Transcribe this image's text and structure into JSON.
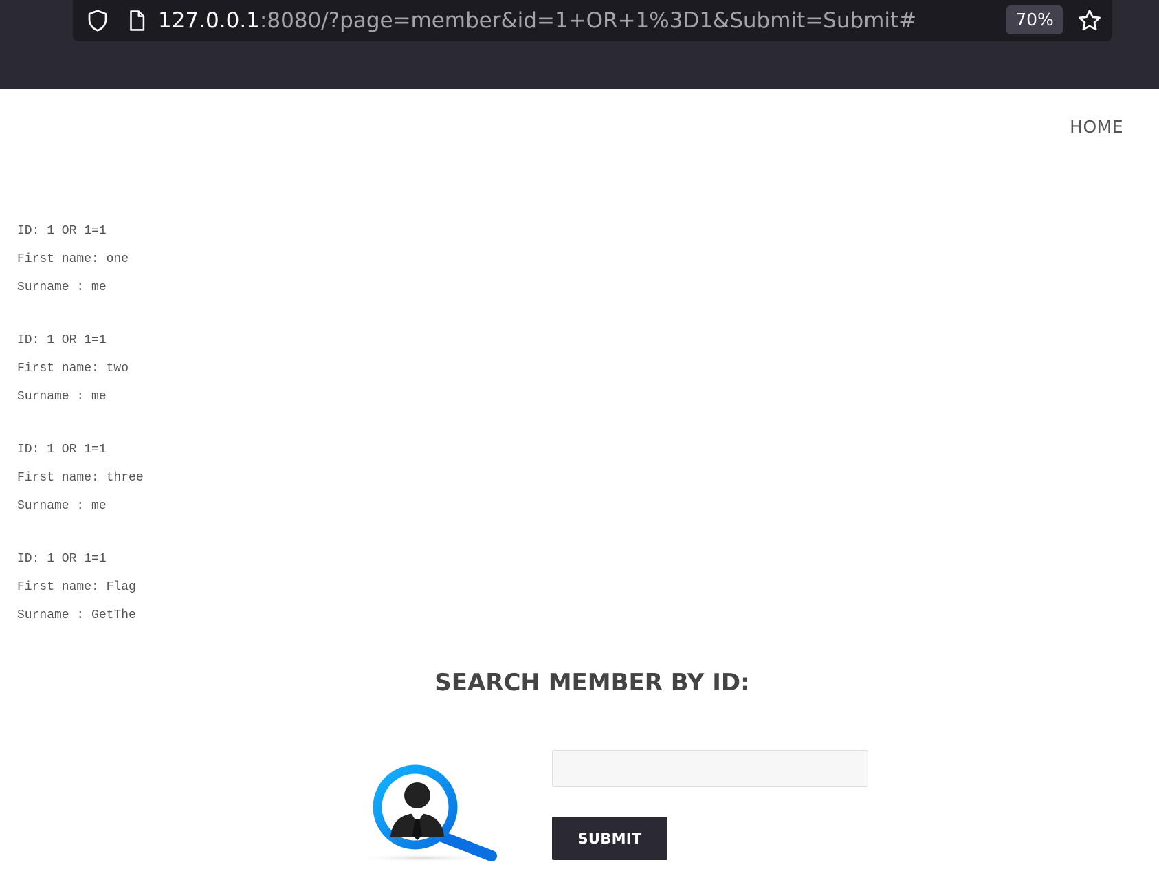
{
  "browser": {
    "url_host": "127.0.0.1",
    "url_rest": ":8080/?page=member&id=1+OR+1%3D1&Submit=Submit#",
    "zoom": "70%",
    "icons": [
      "shield-icon",
      "page-icon",
      "star-icon"
    ]
  },
  "nav": {
    "home_label": "HOME"
  },
  "results": [
    {
      "id": "ID: 1 OR 1=1",
      "first": "First name: one",
      "surname": "Surname : me"
    },
    {
      "id": "ID: 1 OR 1=1",
      "first": "First name: two",
      "surname": "Surname : me"
    },
    {
      "id": "ID: 1 OR 1=1",
      "first": "First name: three",
      "surname": "Surname : me"
    },
    {
      "id": "ID: 1 OR 1=1",
      "first": "First name: Flag",
      "surname": "Surname : GetThe"
    }
  ],
  "search": {
    "title": "SEARCH MEMBER BY ID:",
    "input_value": "",
    "submit_label": "SUBMIT"
  },
  "colors": {
    "chrome_bg": "#2b2a33",
    "urlbar_bg": "#1c1b22",
    "accent_blue": "#1e90ff",
    "button_bg": "#2b2a33"
  }
}
